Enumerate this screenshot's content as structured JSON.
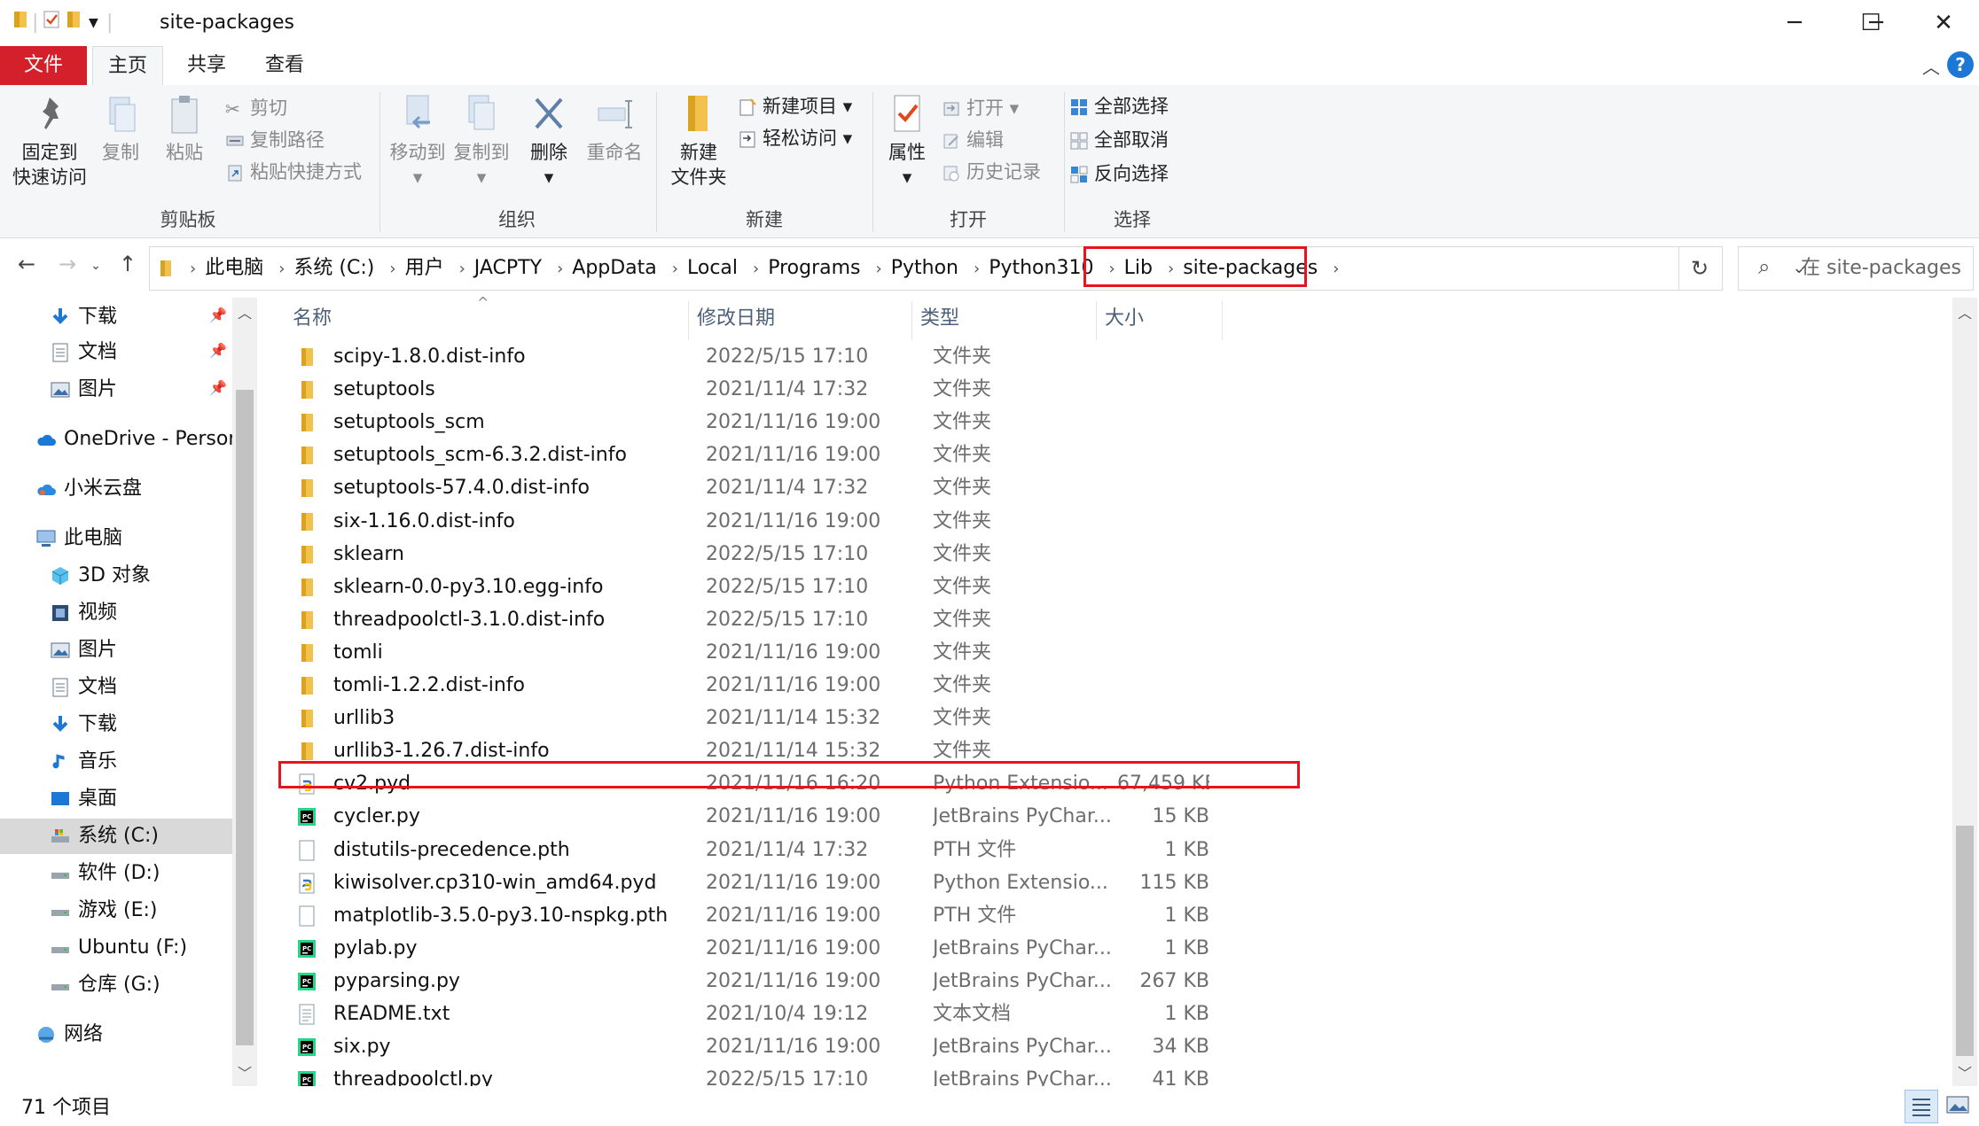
{
  "window": {
    "title": "site-packages",
    "minimize": "─",
    "maximize": "☐",
    "close": "✕"
  },
  "ribbon_tabs": [
    "文件",
    "主页",
    "共享",
    "查看"
  ],
  "ribbon": {
    "clipboard": {
      "label": "剪贴板",
      "pin": "固定到\n快速访问",
      "copy": "复制",
      "paste": "粘贴",
      "cut": "剪切",
      "copy_path": "复制路径",
      "paste_shortcut": "粘贴快捷方式"
    },
    "organize": {
      "label": "组织",
      "move_to": "移动到",
      "copy_to": "复制到",
      "delete": "删除",
      "rename": "重命名"
    },
    "new": {
      "label": "新建",
      "new_folder": "新建\n文件夹",
      "new_item": "新建项目",
      "easy_access": "轻松访问"
    },
    "open": {
      "label": "打开",
      "properties": "属性",
      "open": "打开",
      "edit": "编辑",
      "history": "历史记录"
    },
    "select": {
      "label": "选择",
      "select_all": "全部选择",
      "select_none": "全部取消",
      "invert": "反向选择"
    }
  },
  "address": {
    "crumbs": [
      "此电脑",
      "系统 (C:)",
      "用户",
      "JACPTY",
      "AppData",
      "Local",
      "Programs",
      "Python",
      "Python310",
      "Lib",
      "site-packages"
    ],
    "search_placeholder": "在 site-packages ..."
  },
  "nav_pane": {
    "items": [
      {
        "label": "下载",
        "icon": "download-arrow-icon",
        "pinned": true
      },
      {
        "label": "文档",
        "icon": "document-icon",
        "pinned": true
      },
      {
        "label": "图片",
        "icon": "picture-icon",
        "pinned": true
      },
      {
        "label": "OneDrive - Person",
        "icon": "onedrive-cloud-icon"
      },
      {
        "label": "小米云盘",
        "icon": "cloud-icon"
      },
      {
        "label": "此电脑",
        "icon": "computer-icon"
      },
      {
        "label": "3D 对象",
        "icon": "cube-icon"
      },
      {
        "label": "视频",
        "icon": "video-icon"
      },
      {
        "label": "图片",
        "icon": "picture-icon"
      },
      {
        "label": "文档",
        "icon": "document-icon"
      },
      {
        "label": "下载",
        "icon": "download-arrow-icon"
      },
      {
        "label": "音乐",
        "icon": "music-note-icon"
      },
      {
        "label": "桌面",
        "icon": "desktop-icon"
      },
      {
        "label": "系统 (C:)",
        "icon": "system-drive-icon",
        "selected": true
      },
      {
        "label": "软件 (D:)",
        "icon": "drive-icon"
      },
      {
        "label": "游戏 (E:)",
        "icon": "drive-icon"
      },
      {
        "label": "Ubuntu (F:)",
        "icon": "drive-icon"
      },
      {
        "label": "仓库 (G:)",
        "icon": "drive-icon"
      },
      {
        "label": "网络",
        "icon": "network-icon"
      }
    ]
  },
  "file_list": {
    "columns": {
      "name": "名称",
      "date": "修改日期",
      "type": "类型",
      "size": "大小"
    },
    "rows": [
      {
        "name": "scipy-1.8.0.dist-info",
        "date": "2022/5/15 17:10",
        "type": "文件夹",
        "size": "",
        "icon": "folder-icon"
      },
      {
        "name": "setuptools",
        "date": "2021/11/4 17:32",
        "type": "文件夹",
        "size": "",
        "icon": "folder-icon"
      },
      {
        "name": "setuptools_scm",
        "date": "2021/11/16 19:00",
        "type": "文件夹",
        "size": "",
        "icon": "folder-icon"
      },
      {
        "name": "setuptools_scm-6.3.2.dist-info",
        "date": "2021/11/16 19:00",
        "type": "文件夹",
        "size": "",
        "icon": "folder-icon"
      },
      {
        "name": "setuptools-57.4.0.dist-info",
        "date": "2021/11/4 17:32",
        "type": "文件夹",
        "size": "",
        "icon": "folder-icon"
      },
      {
        "name": "six-1.16.0.dist-info",
        "date": "2021/11/16 19:00",
        "type": "文件夹",
        "size": "",
        "icon": "folder-icon"
      },
      {
        "name": "sklearn",
        "date": "2022/5/15 17:10",
        "type": "文件夹",
        "size": "",
        "icon": "folder-icon"
      },
      {
        "name": "sklearn-0.0-py3.10.egg-info",
        "date": "2022/5/15 17:10",
        "type": "文件夹",
        "size": "",
        "icon": "folder-icon"
      },
      {
        "name": "threadpoolctl-3.1.0.dist-info",
        "date": "2022/5/15 17:10",
        "type": "文件夹",
        "size": "",
        "icon": "folder-icon"
      },
      {
        "name": "tomli",
        "date": "2021/11/16 19:00",
        "type": "文件夹",
        "size": "",
        "icon": "folder-icon"
      },
      {
        "name": "tomli-1.2.2.dist-info",
        "date": "2021/11/16 19:00",
        "type": "文件夹",
        "size": "",
        "icon": "folder-icon"
      },
      {
        "name": "urllib3",
        "date": "2021/11/14 15:32",
        "type": "文件夹",
        "size": "",
        "icon": "folder-icon"
      },
      {
        "name": "urllib3-1.26.7.dist-info",
        "date": "2021/11/14 15:32",
        "type": "文件夹",
        "size": "",
        "icon": "folder-icon"
      },
      {
        "name": "cv2.pyd",
        "date": "2021/11/16 16:20",
        "type": "Python Extensio...",
        "size": "67,459 KB",
        "icon": "python-file-icon"
      },
      {
        "name": "cycler.py",
        "date": "2021/11/16 19:00",
        "type": "JetBrains PyChar...",
        "size": "15 KB",
        "icon": "pycharm-file-icon"
      },
      {
        "name": "distutils-precedence.pth",
        "date": "2021/11/4 17:32",
        "type": "PTH 文件",
        "size": "1 KB",
        "icon": "blank-file-icon"
      },
      {
        "name": "kiwisolver.cp310-win_amd64.pyd",
        "date": "2021/11/16 19:00",
        "type": "Python Extensio...",
        "size": "115 KB",
        "icon": "python-file-icon"
      },
      {
        "name": "matplotlib-3.5.0-py3.10-nspkg.pth",
        "date": "2021/11/16 19:00",
        "type": "PTH 文件",
        "size": "1 KB",
        "icon": "blank-file-icon"
      },
      {
        "name": "pylab.py",
        "date": "2021/11/16 19:00",
        "type": "JetBrains PyChar...",
        "size": "1 KB",
        "icon": "pycharm-file-icon"
      },
      {
        "name": "pyparsing.py",
        "date": "2021/11/16 19:00",
        "type": "JetBrains PyChar...",
        "size": "267 KB",
        "icon": "pycharm-file-icon"
      },
      {
        "name": "README.txt",
        "date": "2021/10/4 19:12",
        "type": "文本文档",
        "size": "1 KB",
        "icon": "text-file-icon"
      },
      {
        "name": "six.py",
        "date": "2021/11/16 19:00",
        "type": "JetBrains PyChar...",
        "size": "34 KB",
        "icon": "pycharm-file-icon"
      },
      {
        "name": "threadpoolctl.py",
        "date": "2022/5/15 17:10",
        "type": "JetBrains PyChar...",
        "size": "41 KB",
        "icon": "pycharm-file-icon"
      }
    ]
  },
  "status": {
    "item_count": "71 个项目"
  },
  "colors": {
    "file_tab": "#d3202a",
    "highlight_box": "#e8141c",
    "folder": "#f2c14e",
    "accent": "#1d77d4"
  }
}
